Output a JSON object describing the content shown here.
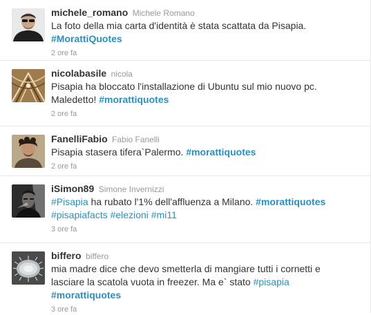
{
  "colors": {
    "link": "#2a8fbd",
    "text": "#333333",
    "muted": "#999999",
    "divider": "#e8e8e8"
  },
  "tweets": [
    {
      "screen_name": "michele_romano",
      "full_name": "Michele Romano",
      "segments": [
        {
          "text": "La foto della mia carta d'identità è stata scattata da Pisapia.",
          "type": "plain"
        },
        {
          "break": true
        },
        {
          "text": "#MorattiQuotes",
          "type": "hashtag-bold"
        }
      ],
      "time": "2 ore fa",
      "avatar_icon": "avatar-man-sunglasses"
    },
    {
      "screen_name": "nicolabasile",
      "full_name": "nicola",
      "segments": [
        {
          "text": "Pisapia ha bloccato l'installazione di Ubuntu sul mio nuovo pc.",
          "type": "plain"
        },
        {
          "break": true
        },
        {
          "text": "Maledetto! ",
          "type": "plain"
        },
        {
          "text": "#morattiquotes",
          "type": "hashtag-bold"
        }
      ],
      "time": "2 ore fa",
      "avatar_icon": "avatar-gothic-ceiling"
    },
    {
      "screen_name": "FanelliFabio",
      "full_name": "Fabio Fanelli",
      "segments": [
        {
          "text": "Pisapia stasera tifera`Palermo. ",
          "type": "plain"
        },
        {
          "text": "#morattiquotes",
          "type": "hashtag-bold"
        }
      ],
      "time": "2 ore fa",
      "avatar_icon": "avatar-curly-hair-man"
    },
    {
      "screen_name": "iSimon89",
      "full_name": "Simone Invernizzi",
      "segments": [
        {
          "text": "#Pisapia",
          "type": "hashtag"
        },
        {
          "text": " ha rubato l'1% dell'affluenza a Milano. ",
          "type": "plain"
        },
        {
          "text": "#morattiquotes",
          "type": "hashtag-bold"
        },
        {
          "break": true
        },
        {
          "text": "#pisapiafacts",
          "type": "hashtag"
        },
        {
          "text": " ",
          "type": "plain"
        },
        {
          "text": "#elezioni",
          "type": "hashtag"
        },
        {
          "text": " ",
          "type": "plain"
        },
        {
          "text": "#mi11",
          "type": "hashtag"
        }
      ],
      "time": "3 ore fa",
      "avatar_icon": "avatar-dark-portrait"
    },
    {
      "screen_name": "biffero",
      "full_name": "biffero",
      "segments": [
        {
          "text": "mia madre dice che devo smetterla di mangiare tutti i cornetti e",
          "type": "plain"
        },
        {
          "break": true
        },
        {
          "text": "lasciare la scatola vuota in freezer. Ma e` stato ",
          "type": "plain"
        },
        {
          "text": "#pisapia",
          "type": "hashtag"
        },
        {
          "break": true
        },
        {
          "text": "#morattiquotes",
          "type": "hashtag-bold"
        }
      ],
      "time": "3 ore fa",
      "avatar_icon": "avatar-microbe"
    }
  ]
}
